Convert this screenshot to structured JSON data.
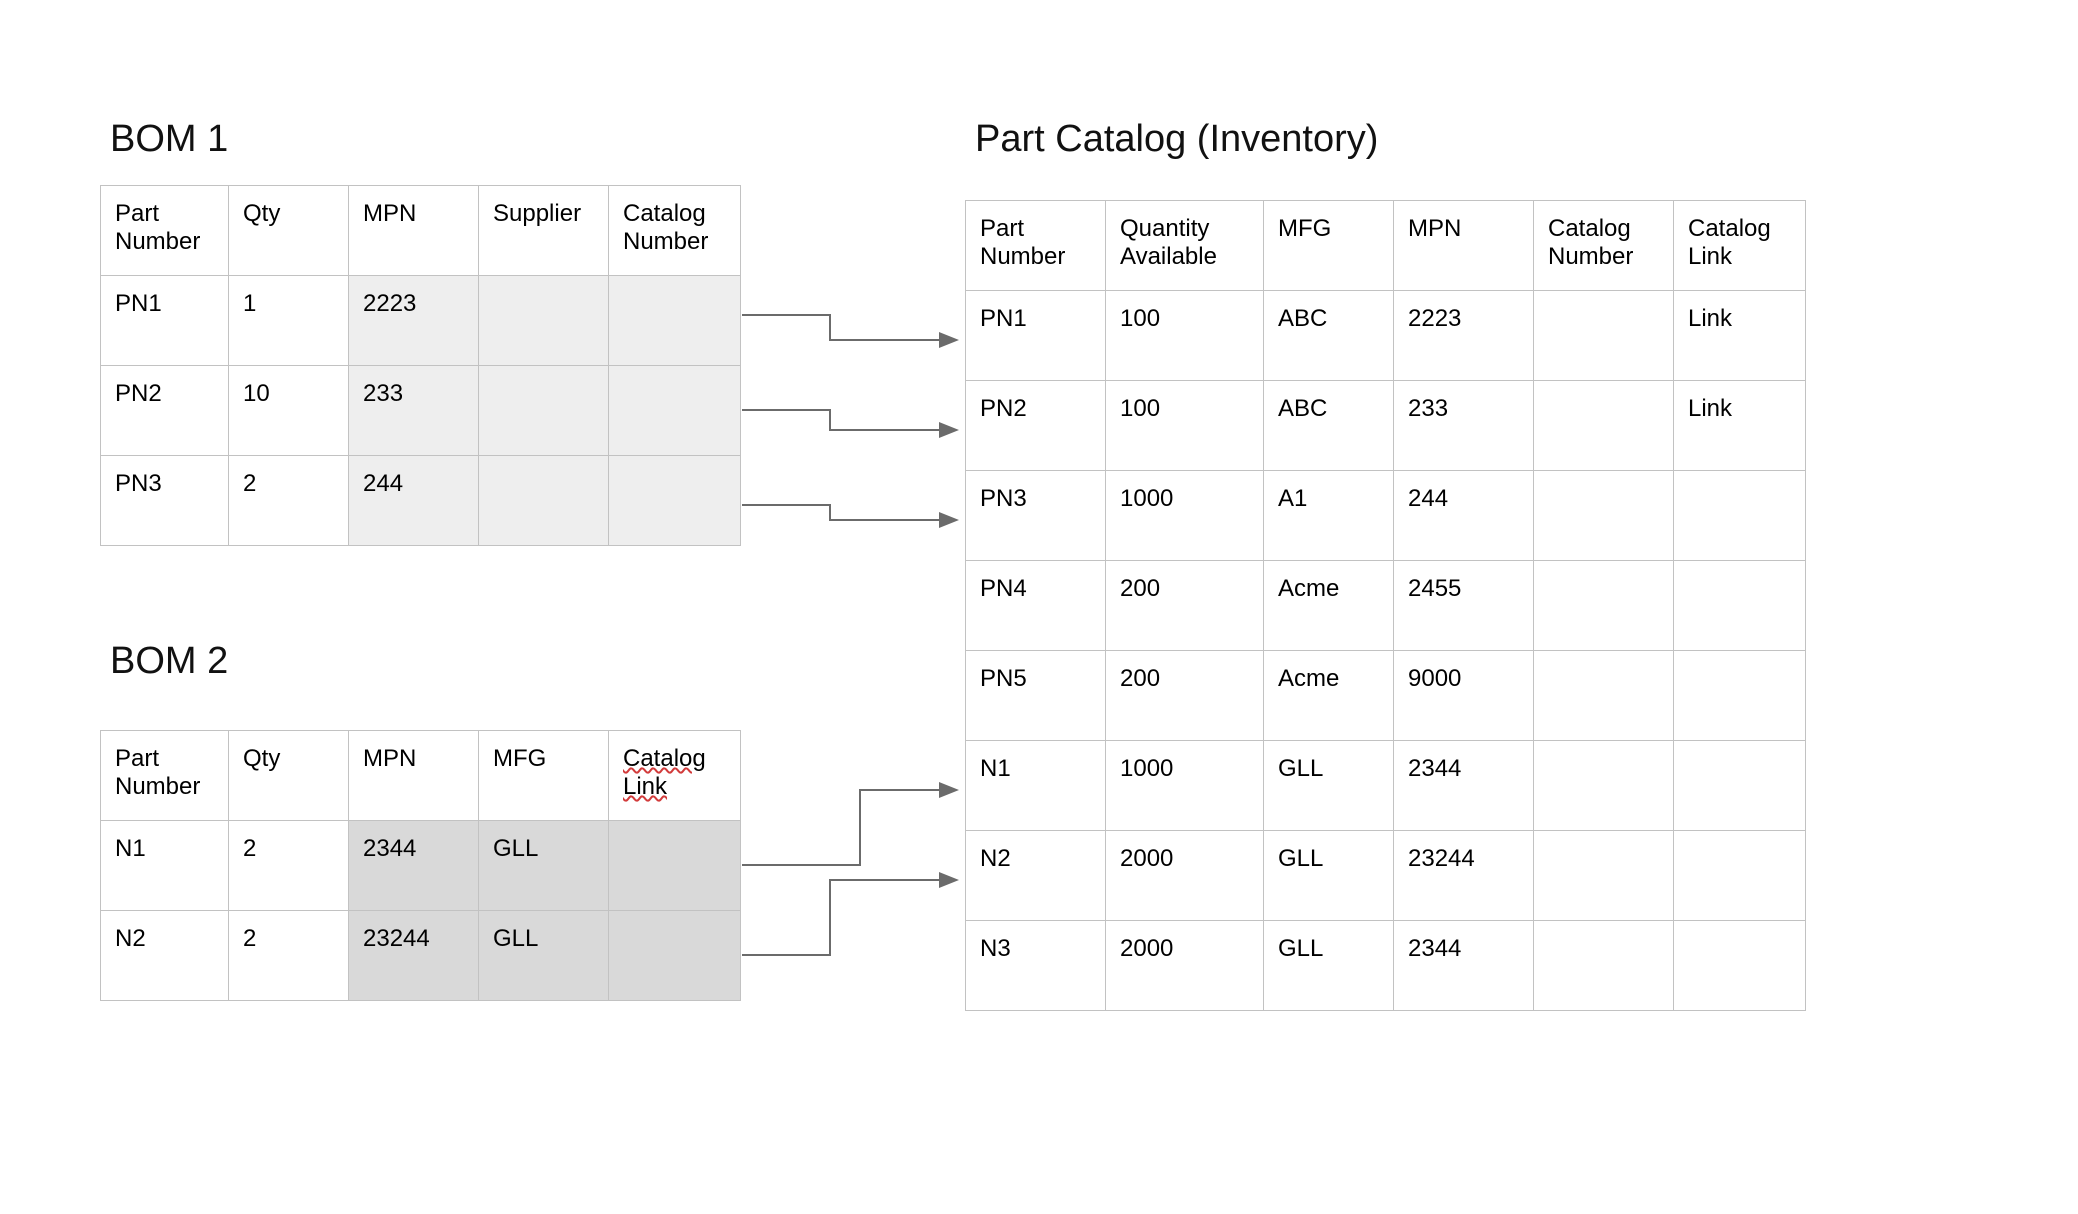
{
  "bom1": {
    "title": "BOM 1",
    "headers": [
      "Part Number",
      "Qty",
      "MPN",
      "Supplier",
      "Catalog Number"
    ],
    "rows": [
      {
        "part_number": "PN1",
        "qty": "1",
        "mpn": "2223",
        "supplier": "",
        "catalog_number": ""
      },
      {
        "part_number": "PN2",
        "qty": "10",
        "mpn": "233",
        "supplier": "",
        "catalog_number": ""
      },
      {
        "part_number": "PN3",
        "qty": "2",
        "mpn": "244",
        "supplier": "",
        "catalog_number": ""
      }
    ]
  },
  "bom2": {
    "title": "BOM 2",
    "headers": [
      "Part Number",
      "Qty",
      "MPN",
      "MFG",
      "Catalog Link"
    ],
    "rows": [
      {
        "part_number": "N1",
        "qty": "2",
        "mpn": "2344",
        "mfg": "GLL",
        "catalog_link": ""
      },
      {
        "part_number": "N2",
        "qty": "2",
        "mpn": "23244",
        "mfg": "GLL",
        "catalog_link": ""
      }
    ]
  },
  "catalog": {
    "title": "Part Catalog (Inventory)",
    "headers": [
      "Part Number",
      "Quantity Available",
      "MFG",
      "MPN",
      "Catalog Number",
      "Catalog Link"
    ],
    "rows": [
      {
        "part_number": "PN1",
        "quantity_available": "100",
        "mfg": "ABC",
        "mpn": "2223",
        "catalog_number": "",
        "catalog_link": "Link"
      },
      {
        "part_number": "PN2",
        "quantity_available": "100",
        "mfg": "ABC",
        "mpn": "233",
        "catalog_number": "",
        "catalog_link": "Link"
      },
      {
        "part_number": "PN3",
        "quantity_available": "1000",
        "mfg": "A1",
        "mpn": "244",
        "catalog_number": "",
        "catalog_link": ""
      },
      {
        "part_number": "PN4",
        "quantity_available": "200",
        "mfg": "Acme",
        "mpn": "2455",
        "catalog_number": "",
        "catalog_link": ""
      },
      {
        "part_number": "PN5",
        "quantity_available": "200",
        "mfg": "Acme",
        "mpn": "9000",
        "catalog_number": "",
        "catalog_link": ""
      },
      {
        "part_number": "N1",
        "quantity_available": "1000",
        "mfg": "GLL",
        "mpn": "2344",
        "catalog_number": "",
        "catalog_link": ""
      },
      {
        "part_number": "N2",
        "quantity_available": "2000",
        "mfg": "GLL",
        "mpn": "23244",
        "catalog_number": "",
        "catalog_link": ""
      },
      {
        "part_number": "N3",
        "quantity_available": "2000",
        "mfg": "GLL",
        "mpn": "2344",
        "catalog_number": "",
        "catalog_link": ""
      }
    ]
  },
  "connections": [
    {
      "from": "bom1.rows.0",
      "to": "catalog.rows.0"
    },
    {
      "from": "bom1.rows.1",
      "to": "catalog.rows.1"
    },
    {
      "from": "bom1.rows.2",
      "to": "catalog.rows.2"
    },
    {
      "from": "bom2.rows.0",
      "to": "catalog.rows.5"
    },
    {
      "from": "bom2.rows.1",
      "to": "catalog.rows.6"
    }
  ]
}
